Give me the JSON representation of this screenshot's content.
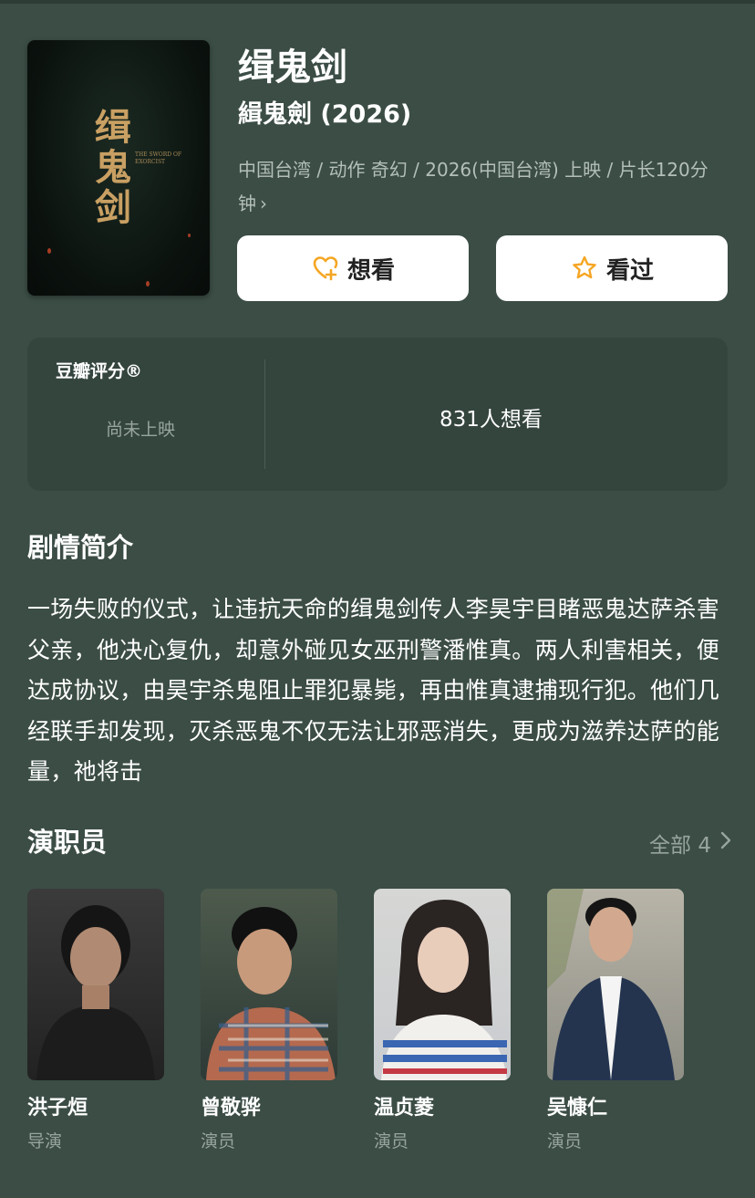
{
  "movie": {
    "poster_title": "缉鬼剑",
    "poster_subtitle": "THE SWORD OF EXORCIST",
    "title": "缉鬼剑",
    "original_title": "緝鬼劍 (2026)",
    "meta": "中国台湾 / 动作 奇幻 / 2026(中国台湾) 上映 / 片长120分钟",
    "meta_chevron": "›"
  },
  "actions": {
    "want_label": "想看",
    "seen_label": "看过"
  },
  "rating": {
    "label": "豆瓣评分®",
    "status": "尚未上映",
    "want_count": "831人想看"
  },
  "synopsis": {
    "title": "剧情简介",
    "text": "一场失败的仪式，让违抗天命的缉鬼剑传人李昊宇目睹恶鬼达萨杀害父亲，他决心复仇，却意外碰见女巫刑警潘惟真。两人利害相关，便达成协议，由昊宇杀鬼阻止罪犯暴毙，再由惟真逮捕现行犯。他们几经联手却发现，灭杀恶鬼不仅无法让邪恶消失，更成为滋养达萨的能量，祂将击"
  },
  "cast": {
    "title": "演职员",
    "all_label": "全部 4",
    "members": [
      {
        "name": "洪子烜",
        "role": "导演"
      },
      {
        "name": "曾敬骅",
        "role": "演员"
      },
      {
        "name": "温贞菱",
        "role": "演员"
      },
      {
        "name": "吴慷仁",
        "role": "演员"
      }
    ]
  },
  "colors": {
    "background": "#3b4d45",
    "card": "#34453e",
    "accent_star": "#f5a623",
    "muted_text": "#98a59f"
  }
}
